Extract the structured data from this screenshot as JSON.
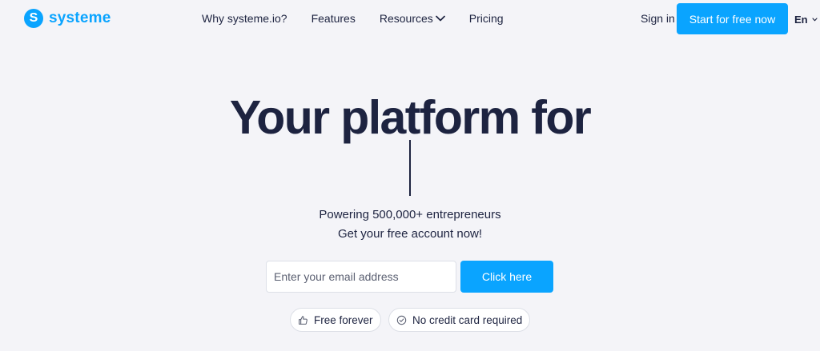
{
  "header": {
    "logo": {
      "mark": "S",
      "text": "systeme"
    },
    "nav": [
      {
        "label": "Why systeme.io?"
      },
      {
        "label": "Features"
      },
      {
        "label": "Resources",
        "icon": "chevron-down-icon"
      },
      {
        "label": "Pricing"
      }
    ],
    "sign_in": "Sign in",
    "cta": "Start for free now",
    "language": {
      "label": "En",
      "icon": "chevron-down-icon"
    }
  },
  "hero": {
    "title": "Your platform for",
    "subtitle_1": "Powering 500,000+ entrepreneurs",
    "subtitle_2": "Get your free account now!",
    "email_placeholder": "Enter your email address",
    "email_value": "",
    "cta": "Click here",
    "badges": [
      {
        "label": "Free forever",
        "icon": "thumbs-up-icon"
      },
      {
        "label": "No credit card required",
        "icon": "check-circle-icon"
      }
    ]
  },
  "colors": {
    "accent": "#0aa4ff",
    "text": "#1d2340",
    "background": "#f4f4f8"
  }
}
